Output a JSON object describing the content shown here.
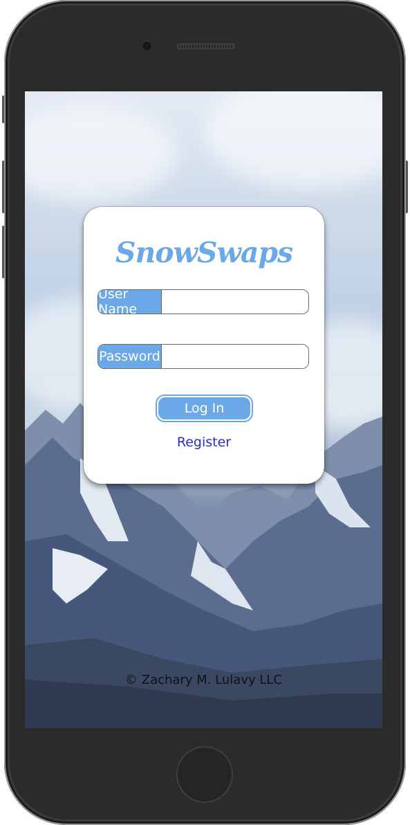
{
  "app": {
    "brand_title": "SnowSwaps",
    "accent_color": "#6aa8e8",
    "link_color": "#2a2ad8"
  },
  "login_form": {
    "username_label": "User Name",
    "username_value": "",
    "password_label": "Password",
    "password_value": "",
    "login_button_label": "Log In",
    "register_link_label": "Register"
  },
  "footer": {
    "copyright": "© Zachary M. Lulavy LLC"
  },
  "device": {
    "frame": "phone",
    "icons": [
      "camera-icon",
      "speaker-grille-icon",
      "home-button-icon"
    ]
  }
}
